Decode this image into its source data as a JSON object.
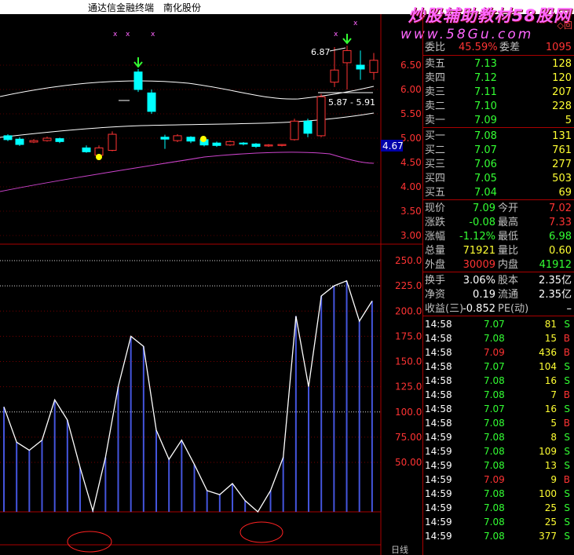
{
  "window": {
    "app_name": "通达信金融终端",
    "stock_name": "南化股份",
    "watermark": "炒股辅助教材58股网",
    "watermark_url": "www.58Gu.com",
    "top_icon": "◇回"
  },
  "price_chart": {
    "y_ticks": [
      "6.50",
      "6.00",
      "5.50",
      "5.00",
      "4.50",
      "4.00",
      "3.50",
      "3.00"
    ],
    "current_price_tag": "4.67",
    "annotation_high": "6.87",
    "annotation_range": "5.87 - 5.91",
    "markers": [
      "x",
      "x",
      "x",
      "x",
      "x"
    ]
  },
  "indicator_chart": {
    "y_ticks": [
      "250.00",
      "225.00",
      "200.00",
      "175.00",
      "150.00",
      "125.00",
      "100.00",
      "75.00",
      "50.00"
    ],
    "period_label": "日线",
    "values": [
      105,
      70,
      62,
      72,
      112,
      92,
      45,
      2,
      55,
      125,
      175,
      165,
      82,
      53,
      72,
      48,
      22,
      18,
      29,
      12,
      1,
      22,
      55,
      195,
      125,
      215,
      225,
      230,
      190,
      210
    ]
  },
  "quote_panel": {
    "weibi_label": "委比",
    "weibi_value": "45.59%",
    "weicha_label": "委差",
    "weicha_value": "1095",
    "sell": [
      {
        "label": "卖五",
        "price": "7.13",
        "vol": "128"
      },
      {
        "label": "卖四",
        "price": "7.12",
        "vol": "120"
      },
      {
        "label": "卖三",
        "price": "7.11",
        "vol": "207"
      },
      {
        "label": "卖二",
        "price": "7.10",
        "vol": "228"
      },
      {
        "label": "卖一",
        "price": "7.09",
        "vol": "5"
      }
    ],
    "buy": [
      {
        "label": "买一",
        "price": "7.08",
        "vol": "131"
      },
      {
        "label": "买二",
        "price": "7.07",
        "vol": "761"
      },
      {
        "label": "买三",
        "price": "7.06",
        "vol": "277"
      },
      {
        "label": "买四",
        "price": "7.05",
        "vol": "503"
      },
      {
        "label": "买五",
        "price": "7.04",
        "vol": "69"
      }
    ],
    "stats": [
      {
        "l1": "现价",
        "v1": "7.09",
        "l2": "今开",
        "v2": "7.02"
      },
      {
        "l1": "涨跌",
        "v1": "-0.08",
        "l2": "最高",
        "v2": "7.33"
      },
      {
        "l1": "涨幅",
        "v1": "-1.12%",
        "l2": "最低",
        "v2": "6.98"
      },
      {
        "l1": "总量",
        "v1": "71921",
        "l2": "量比",
        "v2": "0.60"
      },
      {
        "l1": "外盘",
        "v1": "30009",
        "l2": "内盘",
        "v2": "41912"
      }
    ],
    "stats2": [
      {
        "l1": "换手",
        "v1": "3.06%",
        "l2": "股本",
        "v2": "2.35亿"
      },
      {
        "l1": "净资",
        "v1": "0.19",
        "l2": "流通",
        "v2": "2.35亿"
      },
      {
        "l1": "收益(三)",
        "v1": "-0.852",
        "l2": "PE(动)",
        "v2": "–"
      }
    ],
    "ticks": [
      {
        "time": "14:58",
        "price": "7.07",
        "vol": "81",
        "side": "S"
      },
      {
        "time": "14:58",
        "price": "7.08",
        "vol": "15",
        "side": "B"
      },
      {
        "time": "14:58",
        "price": "7.09",
        "vol": "436",
        "side": "B"
      },
      {
        "time": "14:58",
        "price": "7.07",
        "vol": "104",
        "side": "S"
      },
      {
        "time": "14:58",
        "price": "7.08",
        "vol": "16",
        "side": "S"
      },
      {
        "time": "14:58",
        "price": "7.08",
        "vol": "7",
        "side": "B"
      },
      {
        "time": "14:58",
        "price": "7.07",
        "vol": "16",
        "side": "S"
      },
      {
        "time": "14:58",
        "price": "7.08",
        "vol": "5",
        "side": "B"
      },
      {
        "time": "14:59",
        "price": "7.08",
        "vol": "8",
        "side": "S"
      },
      {
        "time": "14:59",
        "price": "7.08",
        "vol": "109",
        "side": "S"
      },
      {
        "time": "14:59",
        "price": "7.08",
        "vol": "13",
        "side": "S"
      },
      {
        "time": "14:59",
        "price": "7.09",
        "vol": "9",
        "side": "B"
      },
      {
        "time": "14:59",
        "price": "7.08",
        "vol": "100",
        "side": "S"
      },
      {
        "time": "14:59",
        "price": "7.08",
        "vol": "25",
        "side": "S"
      },
      {
        "time": "14:59",
        "price": "7.08",
        "vol": "25",
        "side": "S"
      },
      {
        "time": "14:59",
        "price": "7.08",
        "vol": "377",
        "side": "S"
      }
    ]
  },
  "colors": {
    "up": "#ff3333",
    "down": "#00ffff",
    "grid": "#aa0000",
    "panel_green": "#33ff33"
  }
}
